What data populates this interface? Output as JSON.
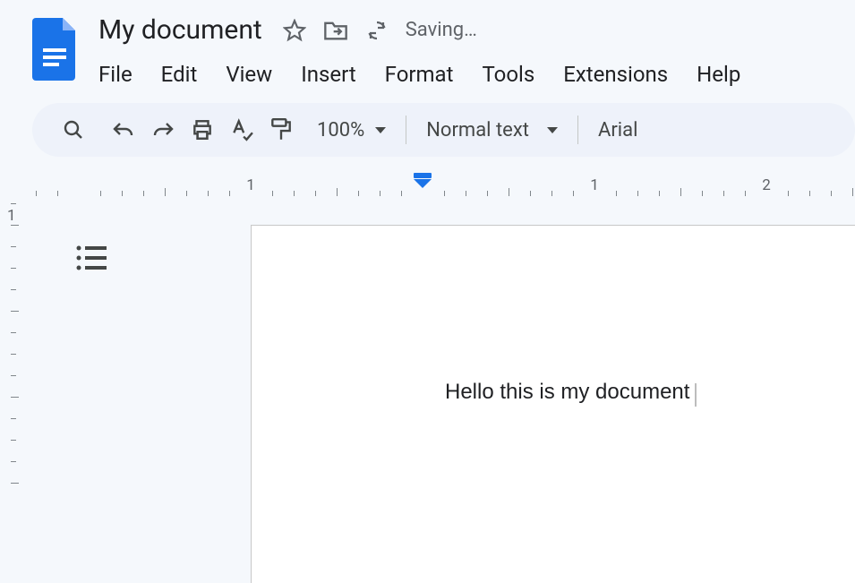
{
  "document": {
    "title": "My document",
    "status_text": "Saving…",
    "content": "Hello this is my document"
  },
  "menubar": {
    "items": [
      "File",
      "Edit",
      "View",
      "Insert",
      "Format",
      "Tools",
      "Extensions",
      "Help"
    ]
  },
  "toolbar": {
    "zoom_label": "100%",
    "style_label": "Normal text",
    "font_label": "Arial"
  },
  "ruler": {
    "h_labels": [
      "1",
      "1",
      "2"
    ],
    "v_labels": [
      "1"
    ]
  }
}
